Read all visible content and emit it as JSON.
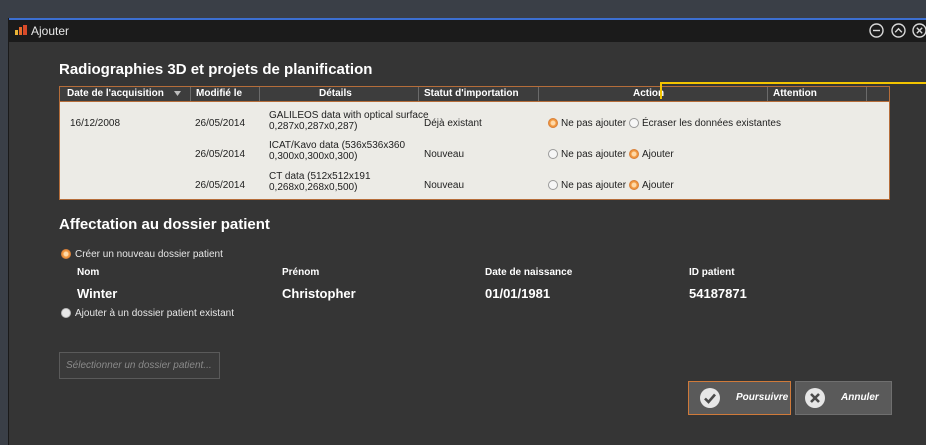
{
  "window": {
    "title": "Ajouter"
  },
  "imports": {
    "heading": "Radiographies 3D et projets de planification",
    "columns": {
      "date": "Date de l'acquisition",
      "modified": "Modifié le",
      "details": "Détails",
      "status": "Statut d'importation",
      "action": "Action",
      "attention": "Attention"
    },
    "rows": [
      {
        "date": "16/12/2008",
        "modified": "26/05/2014",
        "details_line1": "GALILEOS data with optical surface",
        "details_line2": "0,287x0,287x0,287)",
        "status": "Déjà existant",
        "option1_label": "Ne pas ajouter",
        "option1_selected": true,
        "option2_label": "Écraser les données existantes",
        "option2_selected": false
      },
      {
        "date": "",
        "modified": "26/05/2014",
        "details_line1": "ICAT/Kavo data (536x536x360",
        "details_line2": "0,300x0,300x0,300)",
        "status": "Nouveau",
        "option1_label": "Ne pas ajouter",
        "option1_selected": false,
        "option2_label": "Ajouter",
        "option2_selected": true
      },
      {
        "date": "",
        "modified": "26/05/2014",
        "details_line1": "CT data (512x512x191",
        "details_line2": "0,268x0,268x0,500)",
        "status": "Nouveau",
        "option1_label": "Ne pas ajouter",
        "option1_selected": false,
        "option2_label": "Ajouter",
        "option2_selected": true
      }
    ]
  },
  "assignment": {
    "heading": "Affectation au dossier patient",
    "create_new_label": "Créer un nouveau dossier patient",
    "create_new_selected": true,
    "add_existing_label": "Ajouter à un dossier patient existant",
    "add_existing_selected": false,
    "fields": {
      "last_name_label": "Nom",
      "last_name_value": "Winter",
      "first_name_label": "Prénom",
      "first_name_value": "Christopher",
      "birthdate_label": "Date de naissance",
      "birthdate_value": "01/01/1981",
      "patient_id_label": "ID patient",
      "patient_id_value": "54187871"
    },
    "select_placeholder": "Sélectionner un dossier patient..."
  },
  "buttons": {
    "continue_label": "Poursuivre",
    "cancel_label": "Annuler"
  },
  "colors": {
    "accent": "#f0963e",
    "callout": "#f3c400",
    "title_bar_border": "#3c6fd1"
  },
  "icons": {
    "title": "app-icon",
    "minimize": "minimize-icon",
    "maximize": "maximize-icon",
    "close": "close-icon",
    "sort": "sort-desc-icon",
    "continue": "check-icon",
    "cancel": "x-icon"
  }
}
